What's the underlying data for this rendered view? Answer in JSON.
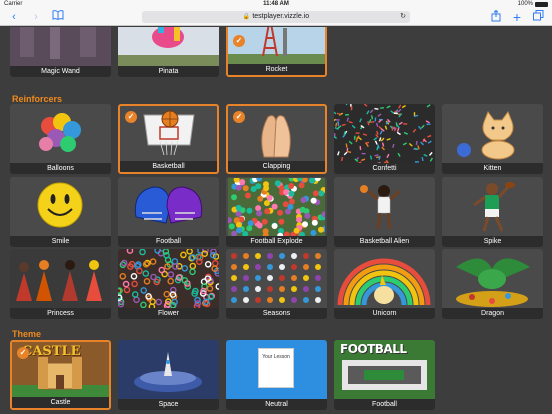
{
  "status_bar": {
    "carrier": "Carrier",
    "time": "11:48 AM",
    "battery": "100%"
  },
  "browser": {
    "url": "testplayer.vizzle.io"
  },
  "top_row": [
    {
      "label": "Magic Wand",
      "selected": false
    },
    {
      "label": "Pinata",
      "selected": false
    },
    {
      "label": "Rocket",
      "selected": true
    }
  ],
  "reinforcers": {
    "title": "Reinforcers",
    "items": [
      {
        "label": "Balloons",
        "selected": false
      },
      {
        "label": "Basketball",
        "selected": true
      },
      {
        "label": "Clapping",
        "selected": true
      },
      {
        "label": "Confetti",
        "selected": false
      },
      {
        "label": "Kitten",
        "selected": false
      },
      {
        "label": "Smile",
        "selected": false
      },
      {
        "label": "Football",
        "selected": false
      },
      {
        "label": "Football Explode",
        "selected": false
      },
      {
        "label": "Basketball Alien",
        "selected": false
      },
      {
        "label": "Spike",
        "selected": false
      },
      {
        "label": "Princess",
        "selected": false
      },
      {
        "label": "Flower",
        "selected": false
      },
      {
        "label": "Seasons",
        "selected": false
      },
      {
        "label": "Unicorn",
        "selected": false
      },
      {
        "label": "Dragon",
        "selected": false
      }
    ]
  },
  "theme": {
    "title": "Theme",
    "items": [
      {
        "label": "Castle",
        "selected": true,
        "art_text": "CASTLE"
      },
      {
        "label": "Space",
        "selected": false
      },
      {
        "label": "Neutral",
        "selected": false,
        "art_text": "Your Lesson"
      },
      {
        "label": "Football",
        "selected": false,
        "art_text": "FOOTBALL"
      }
    ]
  },
  "colors": {
    "accent": "#e8832a",
    "section_title": "#f08a1c",
    "link": "#2f7cf6"
  }
}
